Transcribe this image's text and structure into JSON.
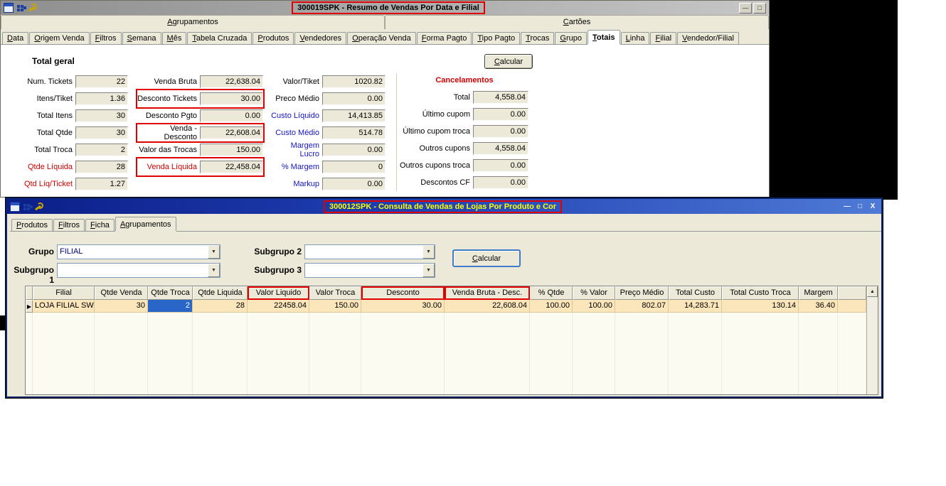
{
  "window1": {
    "title": "300019SPK - Resumo de Vendas Por Data e Filial",
    "toolbar_icons": [
      "window-icon",
      "apps-icon",
      "wrench-icon"
    ],
    "controls": [
      "minimize",
      "maximize"
    ],
    "group_tabs": [
      "Agrupamentos",
      "Cartões"
    ],
    "tabs": [
      "Data",
      "Origem Venda",
      "Filtros",
      "Semana",
      "Mês",
      "Tabela Cruzada",
      "Produtos",
      "Vendedores",
      "Operação Venda",
      "Forma Pagto",
      "Tipo Pagto",
      "Trocas",
      "Grupo",
      "Totais",
      "Linha",
      "Filial",
      "Vendedor/Filial"
    ],
    "active_tab": "Totais",
    "section_title": "Total geral",
    "calcular_label": "Calcular",
    "columns": {
      "col1": [
        {
          "label": "Num. Tickets",
          "value": "22"
        },
        {
          "label": "Itens/Tiket",
          "value": "1.36"
        },
        {
          "label": "Total Itens",
          "value": "30"
        },
        {
          "label": "Total Qtde",
          "value": "30"
        },
        {
          "label": "Total Troca",
          "value": "2"
        },
        {
          "label": "Qtde Líquida",
          "value": "28",
          "red": true
        },
        {
          "label": "Qtd Líq/Ticket",
          "value": "1.27",
          "red": true
        }
      ],
      "col2": [
        {
          "label": "Venda Bruta",
          "value": "22,638.04"
        },
        {
          "label": "Desconto Tickets",
          "value": "30.00",
          "boxed": true
        },
        {
          "label": "Desconto Pgto",
          "value": "0.00"
        },
        {
          "label": "Venda - Desconto",
          "value": "22,608.04",
          "boxed": true
        },
        {
          "label": "Valor das Trocas",
          "value": "150.00"
        },
        {
          "label": "Venda Líquida",
          "value": "22,458.04",
          "red": true,
          "boxed": true
        }
      ],
      "col3": [
        {
          "label": "Valor/Tiket",
          "value": "1020.82"
        },
        {
          "label": "Preco Médio",
          "value": "0.00"
        },
        {
          "label": "Custo Líquido",
          "value": "14,413.85",
          "blue": true
        },
        {
          "label": "Custo Médio",
          "value": "514.78",
          "blue": true
        },
        {
          "label": "Margem Lucro",
          "value": "0.00",
          "blue": true
        },
        {
          "label": "% Margem",
          "value": "0",
          "blue": true
        },
        {
          "label": "Markup",
          "value": "0.00",
          "blue": true
        }
      ]
    },
    "cancelamentos": {
      "title": "Cancelamentos",
      "fields": [
        {
          "label": "Total",
          "value": "4,558.04"
        },
        {
          "label": "Último cupom",
          "value": "0.00"
        },
        {
          "label": "Último cupom troca",
          "value": "0.00"
        },
        {
          "label": "Outros cupons",
          "value": "4,558.04"
        },
        {
          "label": "Outros cupons troca",
          "value": "0.00"
        },
        {
          "label": "Descontos CF",
          "value": "0.00"
        }
      ]
    }
  },
  "window2": {
    "title": "300012SPK - Consulta de Vendas de Lojas Por Produto e Cor",
    "toolbar_icons": [
      "window-icon",
      "apps-icon",
      "wrench-icon"
    ],
    "controls": [
      "minimize",
      "maximize",
      "close"
    ],
    "tabs": [
      "Produtos",
      "Filtros",
      "Ficha",
      "Agrupamentos"
    ],
    "active_tab": "Agrupamentos",
    "filters": {
      "grupo_label": "Grupo",
      "grupo_value": "FILIAL",
      "subgrupo1_label": "Subgrupo 1",
      "subgrupo2_label": "Subgrupo 2",
      "subgrupo3_label": "Subgrupo 3",
      "calcular_label": "Calcular"
    },
    "grid": {
      "columns": [
        "Filial",
        "Qtde Venda",
        "Qtde Troca",
        "Qtde Liquida",
        "Valor Liquido",
        "Valor Troca",
        "Desconto",
        "Venda Bruta - Desc.",
        "% Qtde",
        "% Valor",
        "Preço Médio",
        "Total Custo",
        "Total Custo Troca",
        "Margem"
      ],
      "highlight_columns": [
        "Valor Liquido",
        "Desconto",
        "Venda Bruta - Desc."
      ],
      "rows": [
        [
          "LOJA FILIAL SWEDA",
          "30",
          "2",
          "28",
          "22458.04",
          "150.00",
          "30.00",
          "22,608.04",
          "100.00",
          "100.00",
          "802.07",
          "14,283.71",
          "130.14",
          "36.40"
        ]
      ],
      "selected_cell": {
        "row": 0,
        "col": 2
      }
    }
  },
  "colors": {
    "annotation": "#e00000",
    "window2_title_text": "#ffff00",
    "row_highlight": "#fbe5ba",
    "cell_selection": "#2a65c8"
  }
}
